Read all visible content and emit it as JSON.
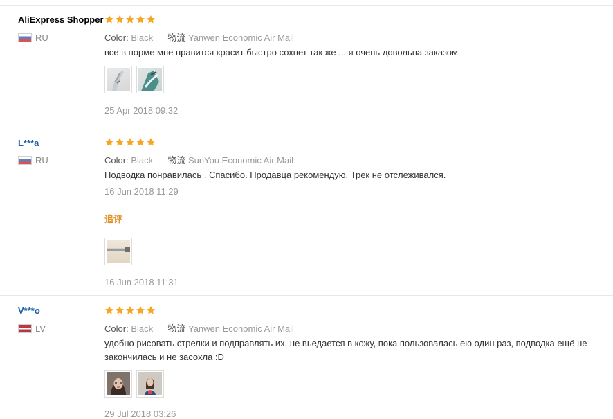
{
  "reviews": [
    {
      "user": "AliExpress Shopper",
      "country": "RU",
      "flag": "ru-flag-icon",
      "stars": 5,
      "color_label": "Color:",
      "color_value": "Black",
      "shipping_label": "物流",
      "shipping_value": "Yanwen Economic Air Mail",
      "text": "все в норме мне нравится красит быстро сохнет так же ... я очень довольна заказом",
      "date": "25 Apr 2018 09:32"
    },
    {
      "user": "L***a",
      "country": "RU",
      "flag": "ru-flag-icon",
      "stars": 5,
      "color_label": "Color:",
      "color_value": "Black",
      "shipping_label": "物流",
      "shipping_value": "SunYou Economic Air Mail",
      "text": "Подводка понравилась . Спасибо. Продавца рекомендую. Трек не отслеживался.",
      "date": "16 Jun 2018 11:29",
      "followup": {
        "label": "追评",
        "date": "16 Jun 2018 11:31"
      }
    },
    {
      "user": "V***o",
      "country": "LV",
      "flag": "lv-flag-icon",
      "stars": 5,
      "color_label": "Color:",
      "color_value": "Black",
      "shipping_label": "物流",
      "shipping_value": "Yanwen Economic Air Mail",
      "text_line1": "удобно рисовать стрелки и подправлять их, не вьедается в кожу, пока пользовалась ею один раз, подводка ещё не",
      "text_line2": "закончилась и не засохла :D",
      "date": "29 Jul 2018 03:26"
    }
  ],
  "colors": {
    "star": "#f5a623",
    "username_link": "#1a5fa8",
    "followup": "#e0952f",
    "muted": "#999999"
  }
}
